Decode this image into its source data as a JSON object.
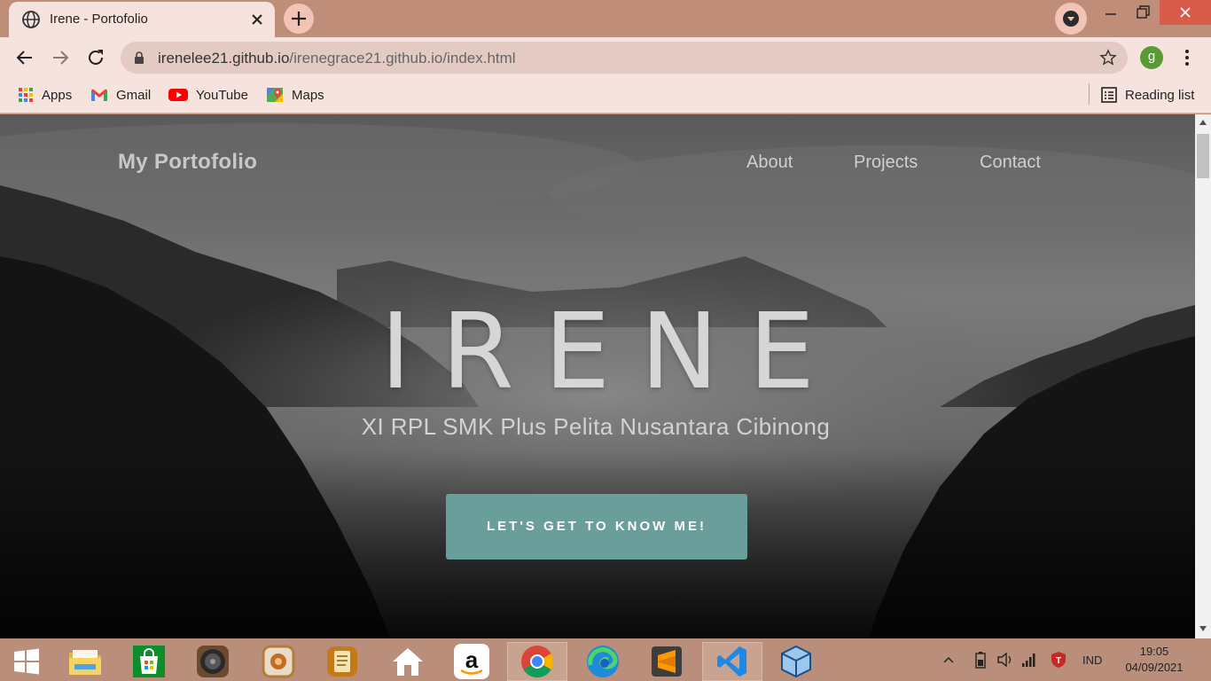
{
  "browser": {
    "tab_title": "Irene - Portofolio",
    "url_host": "irenelee21.github.io",
    "url_path": "/irenegrace21.github.io/index.html",
    "profile_initial": "g",
    "bookmarks": [
      "Apps",
      "Gmail",
      "YouTube",
      "Maps"
    ],
    "reading_list": "Reading list"
  },
  "page": {
    "brand": "My Portofolio",
    "nav": [
      "About",
      "Projects",
      "Contact"
    ],
    "hero_title": "IRENE",
    "hero_subtitle": "XI RPL SMK Plus Pelita Nusantara Cibinong",
    "cta_label": "LET'S GET TO KNOW ME!"
  },
  "taskbar": {
    "apps": [
      "start-icon",
      "file-explorer-icon",
      "microsoft-store-icon",
      "music-player-icon",
      "photo-viewer-icon",
      "notes-icon",
      "home-icon",
      "amazon-icon",
      "chrome-icon",
      "edge-icon",
      "sublime-text-icon",
      "vscode-icon",
      "virtualbox-icon"
    ],
    "language": "IND",
    "time": "19:05",
    "date": "04/09/2021"
  },
  "colors": {
    "chrome_frame": "#c08e78",
    "chrome_toolbar": "#f7e3dd",
    "cta_button": "#6a9e9a",
    "taskbar": "#b98f7b"
  }
}
